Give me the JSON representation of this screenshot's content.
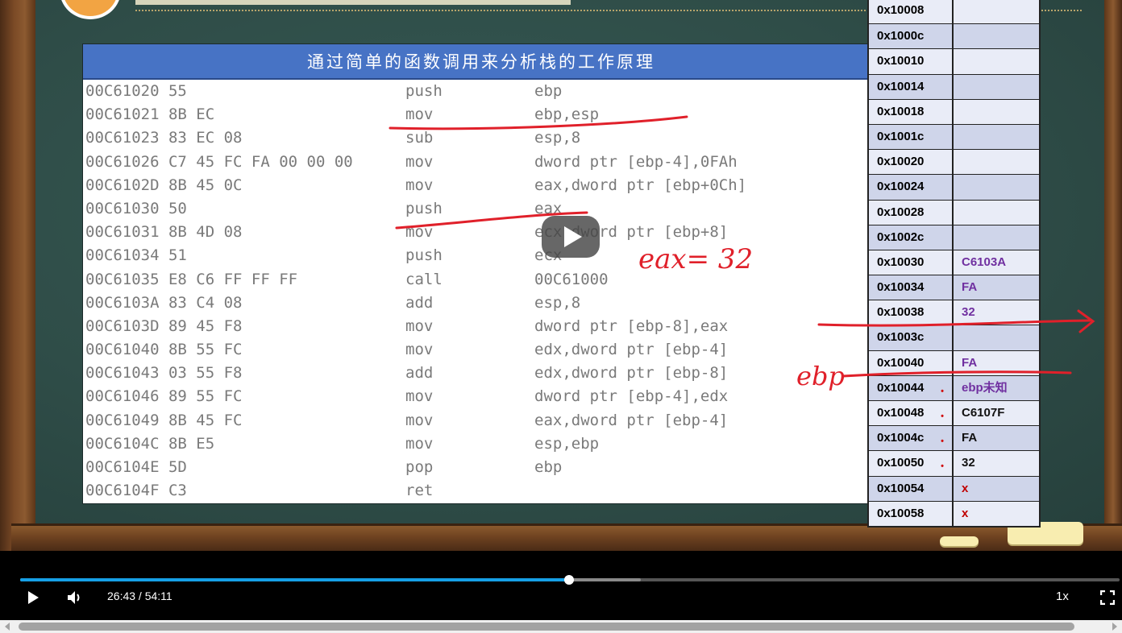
{
  "slide": {
    "table_title": "通过简单的函数调用来分析栈的工作原理",
    "code": [
      {
        "addr": "00C61020 55",
        "mnemonic": "push",
        "operands": "ebp"
      },
      {
        "addr": "00C61021 8B EC",
        "mnemonic": "mov",
        "operands": "ebp,esp"
      },
      {
        "addr": "00C61023 83 EC 08",
        "mnemonic": "sub",
        "operands": "esp,8"
      },
      {
        "addr": "00C61026 C7 45 FC FA 00 00 00",
        "mnemonic": "mov",
        "operands": "dword ptr [ebp-4],0FAh"
      },
      {
        "addr": "00C6102D 8B 45 0C",
        "mnemonic": "mov",
        "operands": "eax,dword ptr [ebp+0Ch]"
      },
      {
        "addr": "00C61030 50",
        "mnemonic": "push",
        "operands": "eax"
      },
      {
        "addr": "00C61031 8B 4D 08",
        "mnemonic": "mov",
        "operands": "ecx,dword ptr [ebp+8]"
      },
      {
        "addr": "00C61034 51",
        "mnemonic": "push",
        "operands": "ecx"
      },
      {
        "addr": "00C61035 E8 C6 FF FF FF",
        "mnemonic": "call",
        "operands": "00C61000"
      },
      {
        "addr": "00C6103A 83 C4 08",
        "mnemonic": "add",
        "operands": "esp,8"
      },
      {
        "addr": "00C6103D 89 45 F8",
        "mnemonic": "mov",
        "operands": "dword ptr [ebp-8],eax"
      },
      {
        "addr": "00C61040 8B 55 FC",
        "mnemonic": "mov",
        "operands": "edx,dword ptr [ebp-4]"
      },
      {
        "addr": "00C61043 03 55 F8",
        "mnemonic": "add",
        "operands": "edx,dword ptr [ebp-8]"
      },
      {
        "addr": "00C61046 89 55 FC",
        "mnemonic": "mov",
        "operands": "dword ptr [ebp-4],edx"
      },
      {
        "addr": "00C61049 8B 45 FC",
        "mnemonic": "mov",
        "operands": "eax,dword ptr [ebp-4]"
      },
      {
        "addr": "00C6104C 8B E5",
        "mnemonic": "mov",
        "operands": "esp,ebp"
      },
      {
        "addr": "00C6104E 5D",
        "mnemonic": "pop",
        "operands": "ebp"
      },
      {
        "addr": "00C6104F C3",
        "mnemonic": "ret",
        "operands": ""
      }
    ],
    "stack": [
      {
        "addr": "0x10008",
        "value": "",
        "dot": false
      },
      {
        "addr": "0x1000c",
        "value": "",
        "dot": false
      },
      {
        "addr": "0x10010",
        "value": "",
        "dot": false
      },
      {
        "addr": "0x10014",
        "value": "",
        "dot": false
      },
      {
        "addr": "0x10018",
        "value": "",
        "dot": false
      },
      {
        "addr": "0x1001c",
        "value": "",
        "dot": false
      },
      {
        "addr": "0x10020",
        "value": "",
        "dot": false
      },
      {
        "addr": "0x10024",
        "value": "",
        "dot": false
      },
      {
        "addr": "0x10028",
        "value": "",
        "dot": false
      },
      {
        "addr": "0x1002c",
        "value": "",
        "dot": false
      },
      {
        "addr": "0x10030",
        "value": "C6103A",
        "dot": false,
        "color": "#7030a0"
      },
      {
        "addr": "0x10034",
        "value": "FA",
        "dot": false,
        "color": "#7030a0"
      },
      {
        "addr": "0x10038",
        "value": "32",
        "dot": false,
        "color": "#7030a0"
      },
      {
        "addr": "0x1003c",
        "value": "",
        "dot": false
      },
      {
        "addr": "0x10040",
        "value": "FA",
        "dot": false,
        "color": "#7030a0"
      },
      {
        "addr": "0x10044",
        "value": "ebp未知",
        "dot": true,
        "color": "#7030a0"
      },
      {
        "addr": "0x10048",
        "value": "C6107F",
        "dot": true,
        "color": "#111111"
      },
      {
        "addr": "0x1004c",
        "value": "FA",
        "dot": true,
        "color": "#111111"
      },
      {
        "addr": "0x10050",
        "value": "32",
        "dot": true,
        "color": "#111111"
      },
      {
        "addr": "0x10054",
        "value": "x",
        "dot": false,
        "color": "#c00000"
      },
      {
        "addr": "0x10058",
        "value": "x",
        "dot": false,
        "color": "#c00000"
      }
    ],
    "annotations": {
      "eax_note": "eax= 32",
      "ebp_note": "ebp"
    },
    "colors": {
      "stack_shade_a": "#e9ecf7",
      "stack_shade_b": "#cfd5ea",
      "table_header": "#4773c5",
      "annotation": "#e0202a"
    }
  },
  "player": {
    "time_display": "26:43 / 54:11",
    "speed_label": "1x",
    "progress": 0.4996,
    "buffered": 0.5645,
    "icons": {
      "play": "play-icon",
      "volume": "volume-icon",
      "fullscreen": "fullscreen-icon",
      "center_play": "play-icon"
    }
  }
}
